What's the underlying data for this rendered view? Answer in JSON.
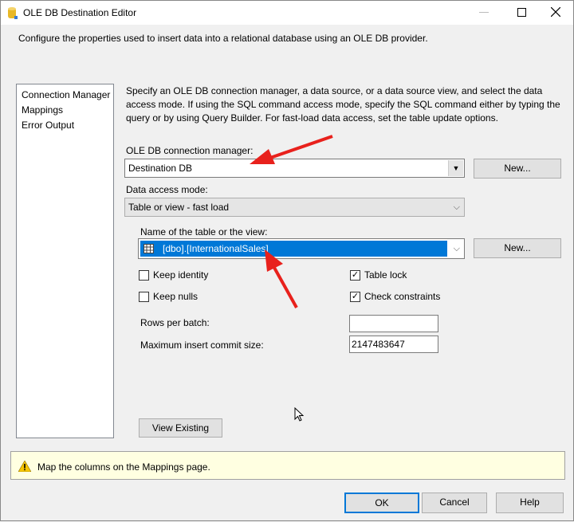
{
  "window": {
    "title": "OLE DB Destination Editor",
    "minimize_icon": "minimize-icon",
    "maximize_icon": "maximize-icon",
    "close_icon": "close-icon"
  },
  "header": {
    "description": "Configure the properties used to insert data into a relational database using an OLE DB provider."
  },
  "sidebar": {
    "items": [
      {
        "label": "Connection Manager"
      },
      {
        "label": "Mappings"
      },
      {
        "label": "Error Output"
      }
    ]
  },
  "main": {
    "intro": "Specify an OLE DB connection manager, a data source, or a data source view, and select the data access mode. If using the SQL command access mode, specify the SQL command either by typing the query or by using Query Builder. For fast-load data access, set the table update options.",
    "connection_label": "OLE DB connection manager:",
    "connection_value": "Destination DB",
    "new_label": "New...",
    "access_mode_label": "Data access mode:",
    "access_mode_value": "Table or view - fast load",
    "table_label": "Name of the table or the view:",
    "table_value": "[dbo].[InternationalSales]",
    "keep_identity": {
      "label": "Keep identity",
      "checked": false
    },
    "keep_nulls": {
      "label": "Keep nulls",
      "checked": false
    },
    "table_lock": {
      "label": "Table lock",
      "checked": true
    },
    "check_constraints": {
      "label": "Check constraints",
      "checked": true
    },
    "rows_per_batch_label": "Rows per batch:",
    "rows_per_batch_value": "",
    "max_commit_label": "Maximum insert commit size:",
    "max_commit_value": "2147483647",
    "view_existing": "View Existing"
  },
  "warning": {
    "text": "Map the columns on the Mappings page."
  },
  "footer": {
    "ok": "OK",
    "cancel": "Cancel",
    "help": "Help"
  },
  "colors": {
    "selection": "#0078d7",
    "annotation_arrow": "#e8211c",
    "warning_bg": "#ffffe1"
  }
}
